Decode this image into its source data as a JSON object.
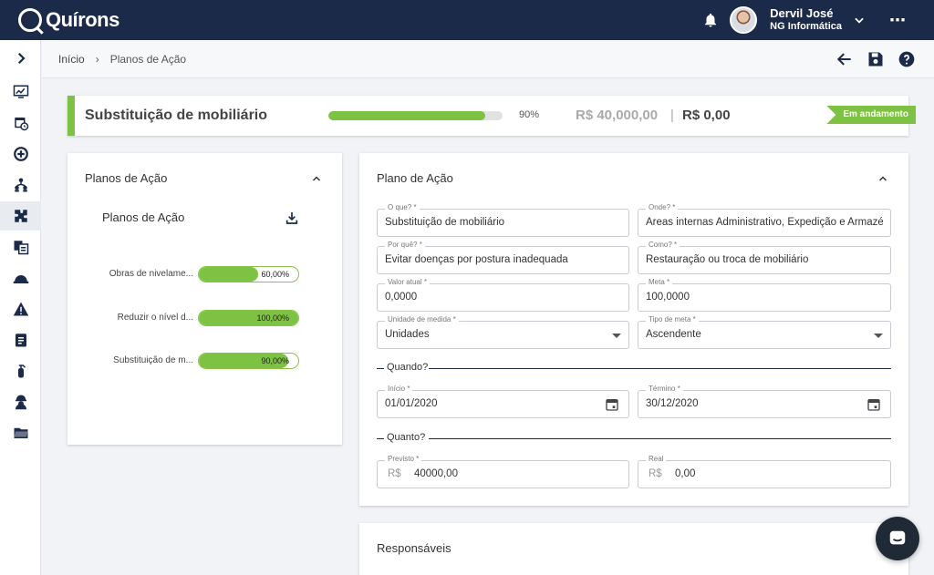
{
  "app": {
    "logo_text": "Quírons"
  },
  "user": {
    "name": "Dervil José",
    "company": "NG Informática"
  },
  "breadcrumb": {
    "home": "Início",
    "current": "Planos de Ação"
  },
  "header": {
    "title": "Substituição de mobiliário",
    "progress": 90,
    "progress_label": "90%",
    "planned_value": "R$ 40,000,00",
    "separator": "|",
    "real_value": "R$ 0,00",
    "status": "Em andamento",
    "accent_color": "#7dc242"
  },
  "left_panel": {
    "title": "Planos de Ação",
    "subtitle": "Planos de Ação",
    "plans": [
      {
        "label": "Obras de nivelame...",
        "progress": 60,
        "pct_label": "60,00%"
      },
      {
        "label": "Reduzir o nível d...",
        "progress": 100,
        "pct_label": "100,00%"
      },
      {
        "label": "Substituição de m...",
        "progress": 90,
        "pct_label": "90,00%"
      }
    ]
  },
  "form": {
    "title": "Plano de Ação",
    "what": {
      "label": "O que? *",
      "value": "Substituição de mobiliário"
    },
    "where": {
      "label": "Onde? *",
      "value": "Áreas internas Administrativo, Expedição e Armazém"
    },
    "why": {
      "label": "Por quê? *",
      "value": "Evitar doenças por postura inadequada"
    },
    "how": {
      "label": "Como? *",
      "value": "Restauração ou troca de mobiliário"
    },
    "current_value": {
      "label": "Valor atual *",
      "value": "0,0000"
    },
    "goal": {
      "label": "Meta *",
      "value": "100,0000"
    },
    "unit": {
      "label": "Unidade de medida *",
      "value": "Unidades"
    },
    "goal_type": {
      "label": "Tipo de meta *",
      "value": "Ascendente"
    },
    "when_section": "Quando?",
    "start": {
      "label": "Início *",
      "value": "01/01/2020"
    },
    "end": {
      "label": "Término *",
      "value": "30/12/2020"
    },
    "how_much_section": "Quanto?",
    "planned": {
      "label": "Previsto *",
      "prefix": "R$",
      "value": "40000,00"
    },
    "real": {
      "label": "Real",
      "prefix": "R$",
      "value": "0,00"
    }
  },
  "responsibles": {
    "title": "Responsáveis"
  },
  "sidebar": {
    "icons": [
      "monitor-icon",
      "calendar-clock-icon",
      "plus-circle-icon",
      "people-tree-icon",
      "puzzle-icon",
      "documents-icon",
      "helmet-icon",
      "warning-icon",
      "clipboard-icon",
      "fire-extinguisher-icon",
      "worker-icon",
      "folder-icon"
    ]
  }
}
